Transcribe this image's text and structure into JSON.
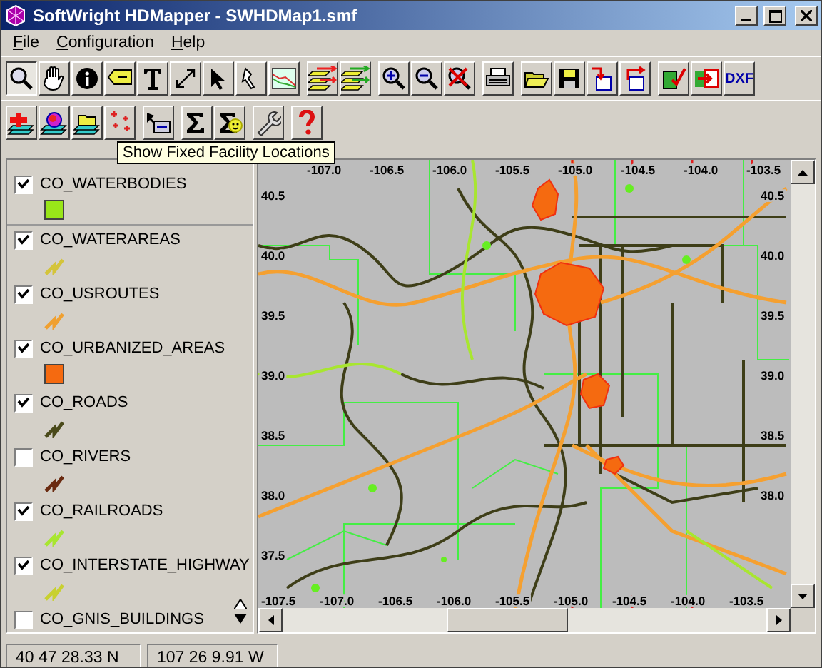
{
  "window": {
    "title": "SoftWright HDMapper - SWHDMap1.smf"
  },
  "menu": [
    {
      "label": "File"
    },
    {
      "label": "Configuration"
    },
    {
      "label": "Help"
    }
  ],
  "toolbar": {
    "buttons": [
      {
        "selected": true
      },
      {
        "selected": false
      },
      {
        "selected": false
      },
      {
        "selected": false
      },
      {
        "selected": false
      },
      {
        "selected": false
      },
      {
        "selected": false
      },
      {
        "selected": false
      },
      {
        "selected": false
      },
      {
        "selected": false
      },
      {
        "selected": false
      },
      {
        "selected": false
      },
      {
        "selected": false
      },
      {
        "selected": false
      },
      {
        "selected": false
      },
      {
        "selected": false
      },
      {
        "selected": false
      },
      {
        "selected": false
      },
      {
        "selected": false
      },
      {
        "selected": false
      },
      {
        "selected": false
      },
      {
        "selected": false,
        "label": "DXF"
      }
    ]
  },
  "tooltip": "Show Fixed Facility Locations",
  "layers": [
    {
      "name": "CO_WATERBODIES",
      "checked": true,
      "kind": "area",
      "color": "#99e619"
    },
    {
      "name": "CO_WATERAREAS",
      "checked": true,
      "kind": "line",
      "color": "#d4c43a"
    },
    {
      "name": "CO_USROUTES",
      "checked": true,
      "kind": "line",
      "color": "#f0a030"
    },
    {
      "name": "CO_URBANIZED_AREAS",
      "checked": true,
      "kind": "area",
      "color": "#f56a10"
    },
    {
      "name": "CO_ROADS",
      "checked": true,
      "kind": "line",
      "color": "#4a4a1a"
    },
    {
      "name": "CO_RIVERS",
      "checked": false,
      "kind": "line",
      "color": "#6a2a10"
    },
    {
      "name": "CO_RAILROADS",
      "checked": true,
      "kind": "line",
      "color": "#a8e630"
    },
    {
      "name": "CO_INTERSTATE_HIGHWAY",
      "checked": true,
      "kind": "line",
      "color": "#c8d030"
    },
    {
      "name": "CO_GNIS_BUILDINGS",
      "checked": false
    }
  ],
  "map": {
    "top_labels": [
      "-107.0",
      "-106.5",
      "-106.0",
      "-105.5",
      "-105.0",
      "-104.5",
      "-104.0",
      "-103.5"
    ],
    "bottom_labels": [
      "-107.5",
      "-107.0",
      "-106.5",
      "-106.0",
      "-105.5",
      "-105.0",
      "-104.5",
      "-104.0",
      "-103.5"
    ],
    "left_labels": [
      "40.5",
      "40.0",
      "39.5",
      "39.0",
      "38.5",
      "38.0",
      "37.5"
    ],
    "right_labels": [
      "40.5",
      "40.0",
      "39.5",
      "39.0",
      "38.5",
      "38.0"
    ]
  },
  "status_bar": {
    "latitude": "40 47 28.33 N",
    "longitude": "107 26 9.91 W"
  }
}
